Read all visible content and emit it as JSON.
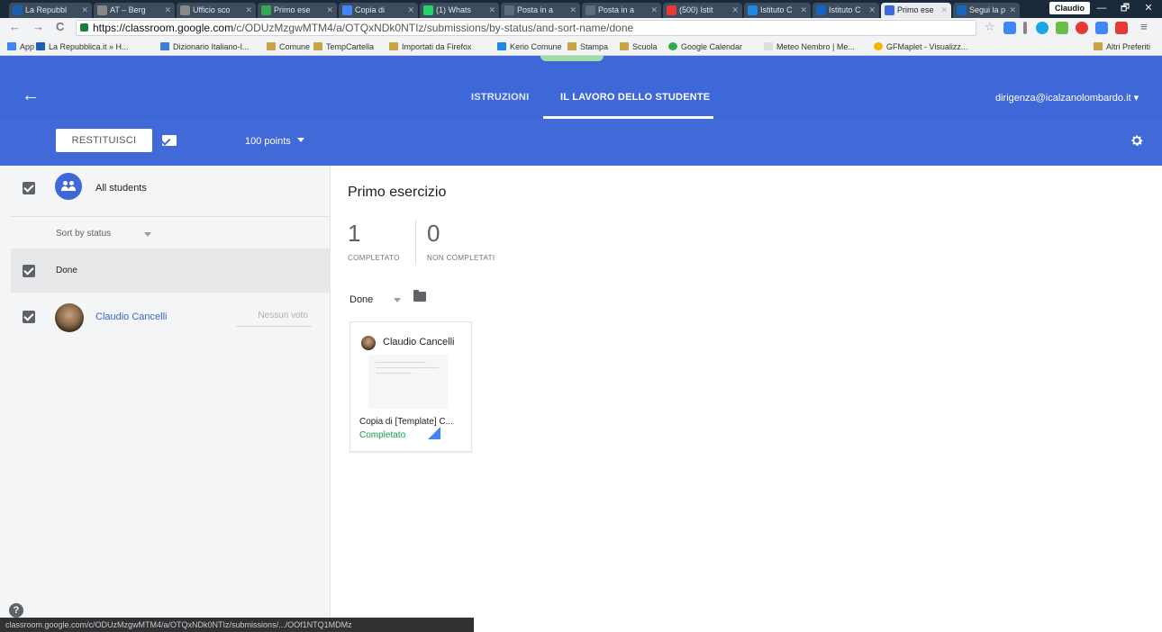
{
  "browser": {
    "tabs": [
      {
        "label": "La Repubbl",
        "color": "#1a5fb4"
      },
      {
        "label": "AT – Berg",
        "color": "#888888"
      },
      {
        "label": "Ufficio sco",
        "color": "#888888"
      },
      {
        "label": "Primo ese",
        "color": "#34a853"
      },
      {
        "label": "Copia di",
        "color": "#4285f4"
      },
      {
        "label": "(1) Whats",
        "color": "#25d366"
      },
      {
        "label": "Posta in a",
        "color": "#5f6b7a"
      },
      {
        "label": "Posta in a",
        "color": "#5f6b7a"
      },
      {
        "label": "(500) Istit",
        "color": "#e53935"
      },
      {
        "label": "Istituto C",
        "color": "#1e88e5"
      },
      {
        "label": "Istituto C",
        "color": "#1565c0"
      },
      {
        "label": "Primo ese",
        "color": "#3e67d8"
      },
      {
        "label": "Segui la p",
        "color": "#1565c0"
      }
    ],
    "profile_name": "Claudio",
    "window_min": "—",
    "window_max": "🗗",
    "window_close": "✕",
    "back_icon": "←",
    "forward_icon": "→",
    "reload_icon": "C",
    "url_host": "https://classroom.google.com",
    "url_path": "/c/ODUzMzgwMTM4/a/OTQxNDk0NTIz/submissions/by-status/and-sort-name/done",
    "bookmarks": [
      {
        "label": "App",
        "color": "#4285f4"
      },
      {
        "label": "La Repubblica.it » H...",
        "color": "#1a5fb4"
      },
      {
        "label": "Dizionario Italiano-I...",
        "color": "#3b7dd8"
      },
      {
        "label": "Comune",
        "color": "#c8a447"
      },
      {
        "label": "TempCartella",
        "color": "#c8a447"
      },
      {
        "label": "Importati da Firefox",
        "color": "#c8a447"
      },
      {
        "label": "Kerio Comune",
        "color": "#1e88e5"
      },
      {
        "label": "Stampa",
        "color": "#c8a447"
      },
      {
        "label": "Scuola",
        "color": "#c8a447"
      },
      {
        "label": "Google Calendar",
        "color": "#34a853"
      },
      {
        "label": "Meteo Nembro | Me...",
        "color": "#dddddd"
      },
      {
        "label": "GFMaplet - Visualizz...",
        "color": "#f4b400"
      }
    ],
    "other_bookmarks": "Altri Preferiti",
    "status_url": "classroom.google.com/c/ODUzMzgwMTM4/a/OTQxNDk0NTIz/submissions/.../OOf1NTQ1MDMz"
  },
  "appbar": {
    "back_icon": "←",
    "tab_instructions": "ISTRUZIONI",
    "tab_student_work": "IL LAVORO DELLO STUDENTE",
    "account": "dirigenza@icalzanolombardo.it ▾"
  },
  "toolbar": {
    "return_label": "RESTITUISCI",
    "points": "100 points",
    "settings_icon": "✱"
  },
  "left": {
    "all_students": "All students",
    "sort_label": "Sort by status",
    "group_label": "Done",
    "student_name": "Claudio Cancelli",
    "grade_placeholder": "Nessun voto",
    "help_icon": "?"
  },
  "main": {
    "assignment_title": "Primo esercizio",
    "completed_count": "1",
    "completed_label": "COMPLETATO",
    "not_completed_count": "0",
    "not_completed_label": "NON COMPLETATI",
    "filter_label": "Done",
    "card": {
      "student_name": "Claudio Cancelli",
      "file_name": "Copia di [Template] C...",
      "status": "Completato"
    }
  },
  "colors": {
    "app_blue": "#3e67d8",
    "toolbar_blue": "#4169d8",
    "status_green": "#0f9d58",
    "link_blue": "#3367d6"
  }
}
